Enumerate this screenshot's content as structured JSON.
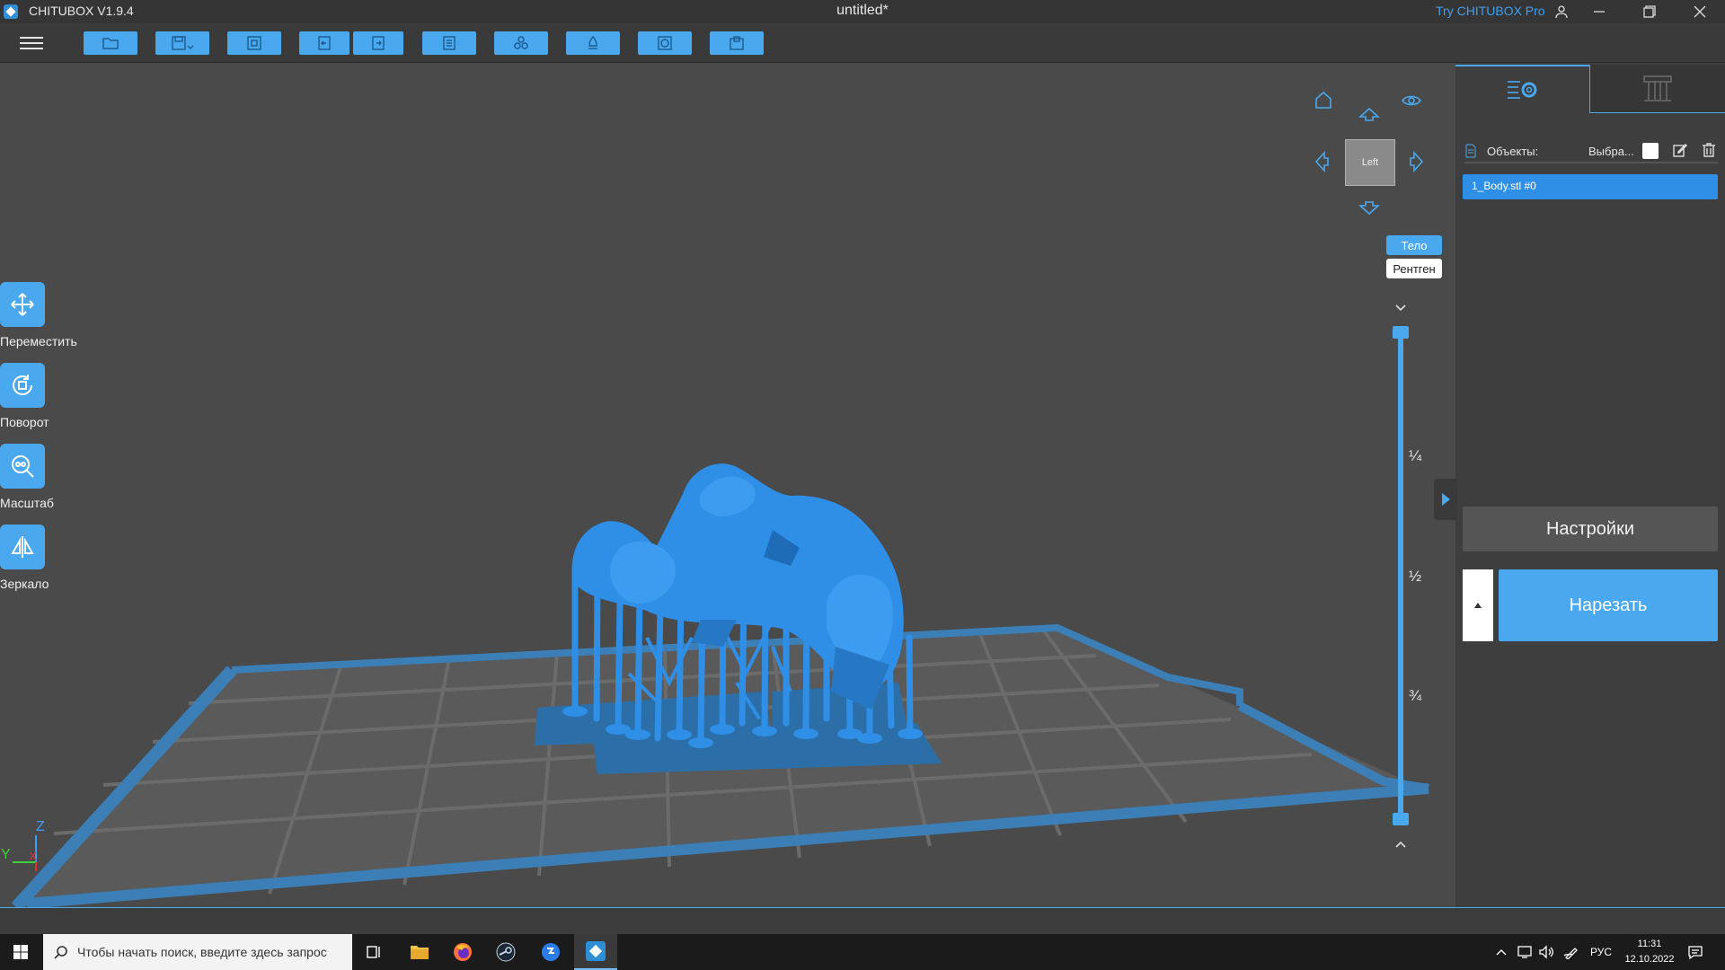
{
  "titlebar": {
    "app_name": "CHITUBOX V1.9.4",
    "document_title": "untitled*",
    "try_pro": "Try CHITUBOX Pro",
    "icons": [
      "user-icon",
      "minimize-icon",
      "restore-icon",
      "close-icon"
    ]
  },
  "toolbar": {
    "buttons": [
      "open-icon",
      "save-icon",
      "snapshot-icon",
      "undo-icon",
      "redo-icon",
      "layout-icon",
      "arrange-icon",
      "support-icon",
      "hollow-icon",
      "drill-icon"
    ]
  },
  "tools": {
    "move": "Переместить",
    "rotate": "Поворот",
    "scale": "Масштаб",
    "mirror": "Зеркало"
  },
  "view": {
    "cube_label": "Left",
    "mode_body": "Тело",
    "mode_xray": "Рентген"
  },
  "layer_slider": {
    "marks": [
      "¼",
      "½",
      "¾"
    ]
  },
  "axes": {
    "z": "Z",
    "y": "Y",
    "x": "X"
  },
  "panel": {
    "objects_label": "Объекты:",
    "select_label": "Выбра...",
    "objects": [
      "1_Body.stl #0"
    ],
    "settings_label": "Настройки",
    "slice_label": "Нарезать"
  },
  "taskbar": {
    "search_placeholder": "Чтобы начать поиск, введите здесь запрос",
    "language": "РУС",
    "time": "11:31",
    "date": "12.10.2022"
  },
  "colors": {
    "accent": "#4aa8ee",
    "model": "#2f8fe6",
    "platform": "#3b7fb6",
    "viewport": "#4a4a4a"
  }
}
